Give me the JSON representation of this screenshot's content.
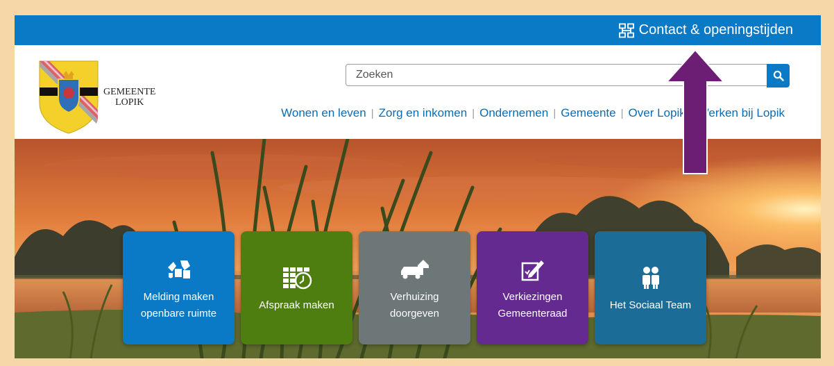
{
  "topbar": {
    "contact_label": "Contact & openingstijden"
  },
  "logo": {
    "line1": "GEMEENTE",
    "line2": "LOPIK"
  },
  "search": {
    "placeholder": "Zoeken"
  },
  "nav": {
    "items": [
      "Wonen en leven",
      "Zorg en inkomen",
      "Ondernemen",
      "Gemeente",
      "Over Lopik",
      "Werken bij Lopik"
    ]
  },
  "tiles": [
    {
      "label": "Melding maken openbare ruimte",
      "icon": "report-icon",
      "color": "#0a7ac6"
    },
    {
      "label": "Afspraak maken",
      "icon": "calendar-clock-icon",
      "color": "#4e7e0f"
    },
    {
      "label": "Verhuizing doorgeven",
      "icon": "moving-truck-icon",
      "color": "#6d7778"
    },
    {
      "label": "Verkiezingen Gemeenteraad",
      "icon": "ballot-pencil-icon",
      "color": "#652a8f"
    },
    {
      "label": "Het Sociaal Team",
      "icon": "people-icon",
      "color": "#1c6c98"
    }
  ],
  "colors": {
    "brand_blue": "#0a7ac6",
    "nav_text": "#0a6db3",
    "arrow": "#6b1e73",
    "frame": "#f5d7a8"
  }
}
